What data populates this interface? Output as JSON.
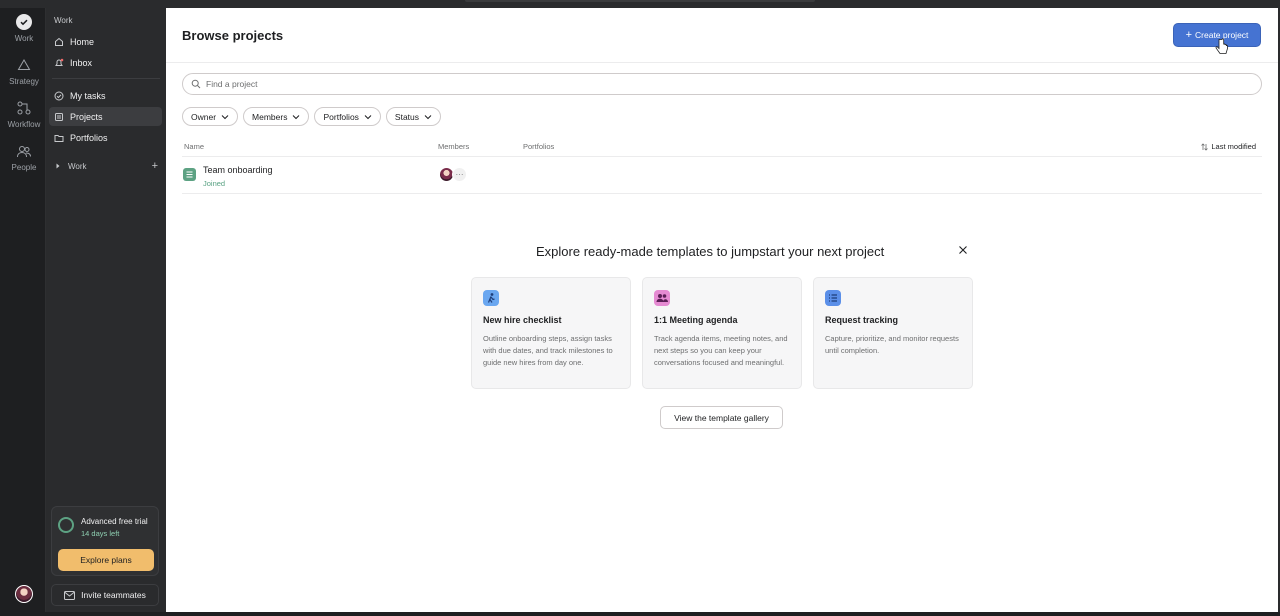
{
  "rail": {
    "items": [
      {
        "label": "Work"
      },
      {
        "label": "Strategy"
      },
      {
        "label": "Workflow"
      },
      {
        "label": "People"
      }
    ]
  },
  "sidebar": {
    "heading": "Work",
    "items": [
      {
        "label": "Home",
        "icon": "home-icon"
      },
      {
        "label": "Inbox",
        "icon": "bell-icon"
      },
      {
        "label": "My tasks",
        "icon": "check-circle-icon"
      },
      {
        "label": "Projects",
        "icon": "clipboard-icon"
      },
      {
        "label": "Portfolios",
        "icon": "folder-icon"
      }
    ],
    "section_label": "Work",
    "trial": {
      "title": "Advanced free trial",
      "subtitle": "14 days left",
      "button": "Explore plans"
    },
    "invite_label": "Invite teammates"
  },
  "main": {
    "title": "Browse projects",
    "create_label": "Create project",
    "search_placeholder": "Find a project",
    "filters": [
      "Owner",
      "Members",
      "Portfolios",
      "Status"
    ],
    "columns": {
      "name": "Name",
      "members": "Members",
      "portfolios": "Portfolios",
      "modified": "Last modified"
    },
    "projects": [
      {
        "name": "Team onboarding",
        "status": "Joined",
        "more": "···"
      }
    ],
    "templates": {
      "heading": "Explore ready-made templates to jumpstart your next project",
      "cards": [
        {
          "title": "New hire checklist",
          "desc": "Outline onboarding steps, assign tasks with due dates, and track milestones to guide new hires from day one.",
          "color": "#6aa7f0"
        },
        {
          "title": "1:1 Meeting agenda",
          "desc": "Track agenda items, meeting notes, and next steps so you can keep your conversations focused and meaningful.",
          "color": "#e58ad2"
        },
        {
          "title": "Request tracking",
          "desc": "Capture, prioritize, and monitor requests until completion.",
          "color": "#5b8fe8"
        }
      ],
      "gallery_label": "View the template gallery"
    }
  },
  "colors": {
    "accent": "#4573d2",
    "trial_button": "#f1bd6c",
    "project_icon": "#5da283"
  }
}
